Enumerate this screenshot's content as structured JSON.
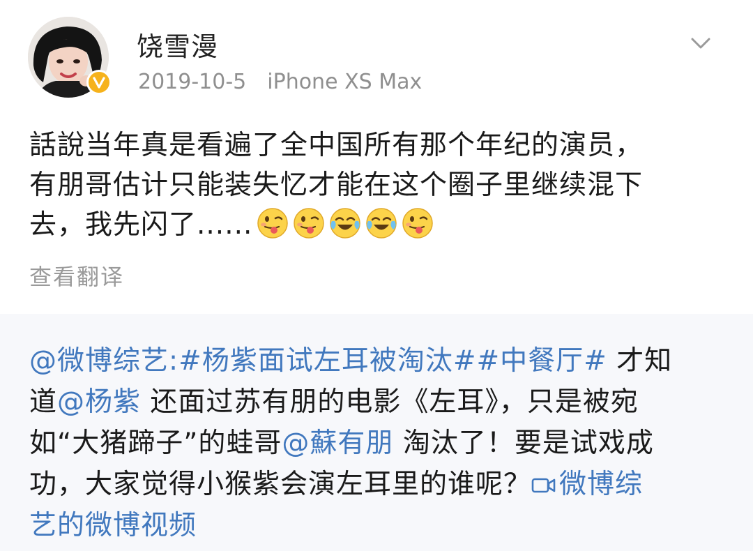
{
  "post": {
    "username": "饶雪漫",
    "date": "2019-10-5",
    "source": "iPhone XS Max",
    "text_lines": [
      "話說当年真是看遍了全中国所有那个年纪的演员，",
      "有朋哥估计只能装失忆才能在这个圈子里继续混下",
      "去，我先闪了......"
    ],
    "emojis": [
      "tongue-emoji",
      "tongue-emoji",
      "laugh-cry-emoji",
      "laugh-cry-emoji",
      "tongue-emoji"
    ],
    "translate_label": "查看翻译"
  },
  "repost": {
    "line1": {
      "mention": "@微博综艺:",
      "topics": "#杨紫面试左耳被淘汰##中餐厅#",
      "text": " 才知"
    },
    "line2": {
      "prefix": "道",
      "mention": "@杨紫",
      "text": " 还面过苏有朋的电影《左耳》，只是被宛"
    },
    "line3": {
      "prefix": "如“大猪蹄子”的蛙哥",
      "mention": "@蘇有朋",
      "text": " 淘汰了！要是试戏成"
    },
    "line4": {
      "text": "功，大家觉得小猴紫会演左耳里的谁呢？",
      "video_link": "微博综"
    },
    "line5": {
      "video_link": "艺的微博视频"
    }
  },
  "colors": {
    "link": "#4178be",
    "verified_badge": "#f6b21b",
    "repost_background": "#f7f8fb"
  },
  "icons": {
    "chevron": "chevron-down-icon",
    "verified": "verified-badge-icon",
    "video": "video-camera-icon"
  }
}
